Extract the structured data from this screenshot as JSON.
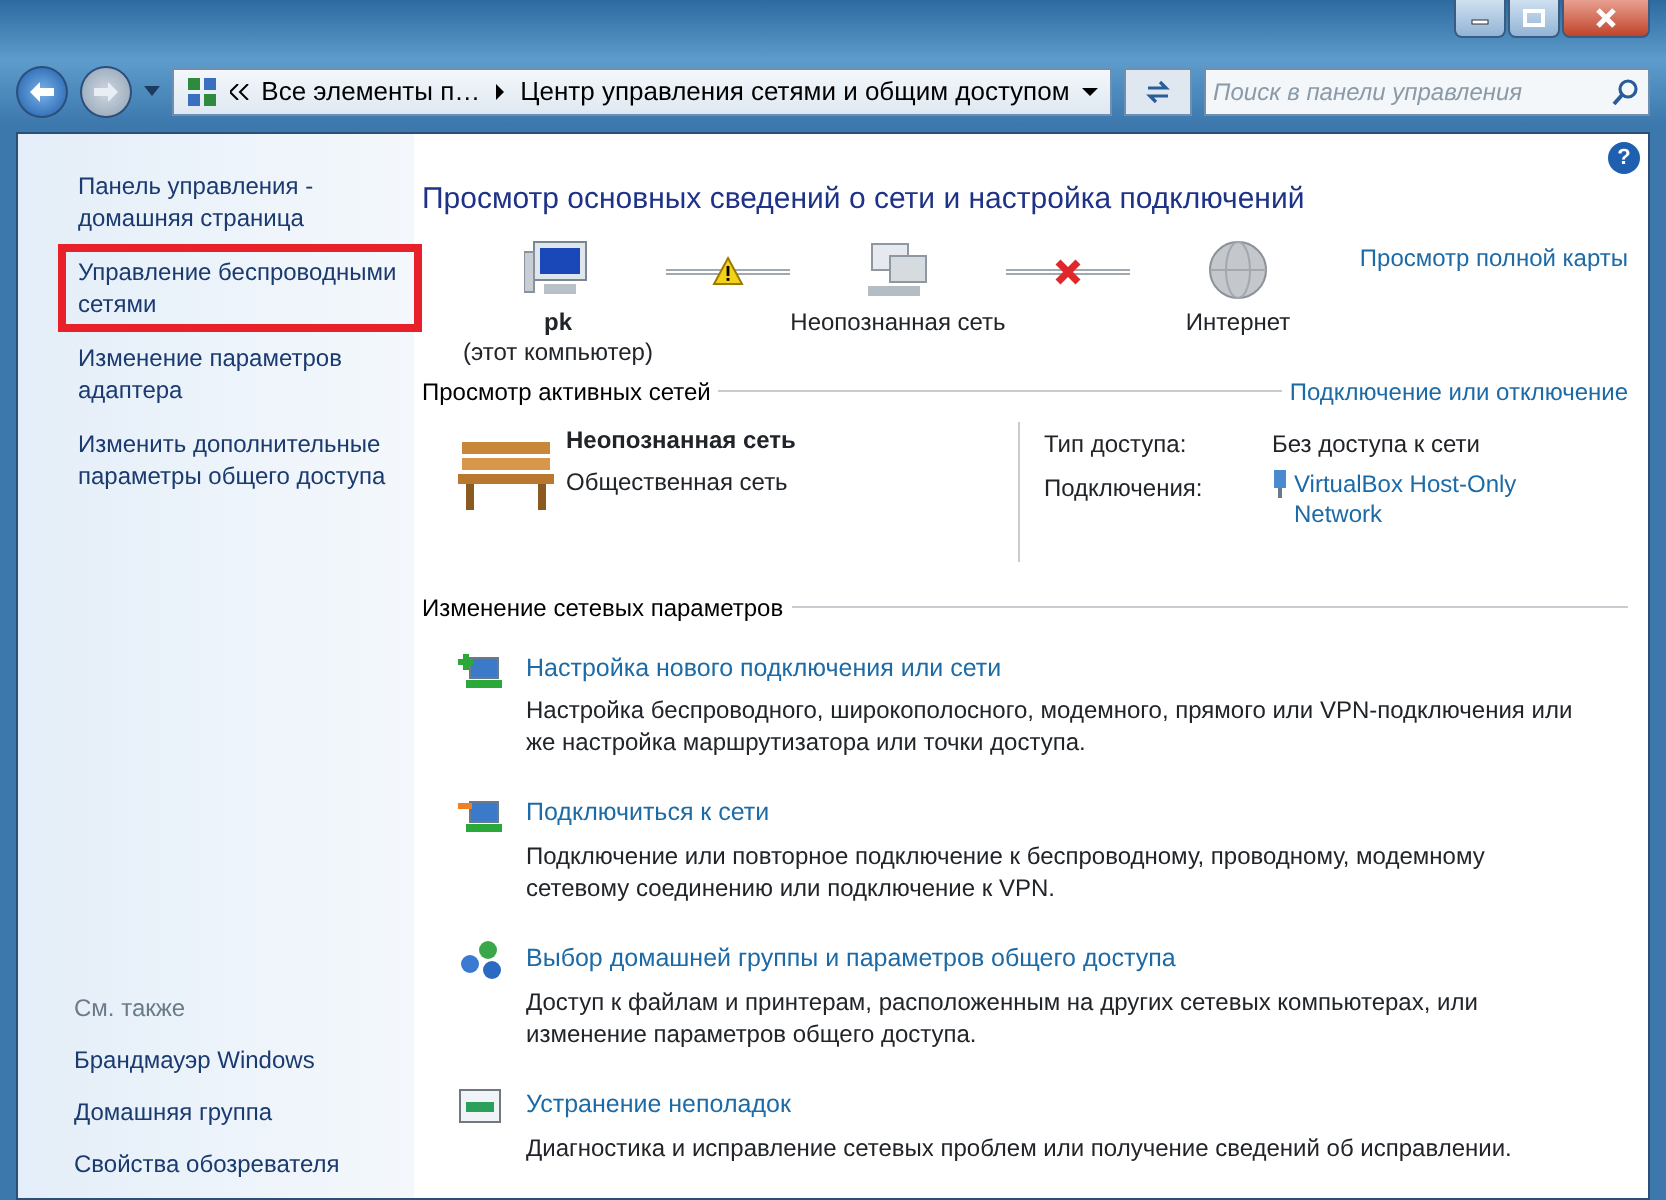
{
  "window": {
    "controls": [
      {
        "kind": "minimize"
      },
      {
        "kind": "maximize"
      },
      {
        "kind": "close"
      }
    ]
  },
  "address": {
    "breadcrumbs": [
      "Все элементы п…",
      "Центр управления сетями и общим доступом"
    ],
    "search": {
      "placeholder": "Поиск в панели управления"
    }
  },
  "sidebar": {
    "links": [
      {
        "text": "Панель управления - домашняя страница",
        "highlighted": false
      },
      {
        "text": "Управление беспроводными сетями",
        "highlighted": true
      },
      {
        "text": "Изменение параметров адаптера",
        "highlighted": false
      },
      {
        "text": "Изменить дополнительные параметры общего доступа",
        "highlighted": false
      }
    ],
    "see_also": {
      "title": "См. также",
      "links": [
        "Брандмауэр Windows",
        "Домашняя группа",
        "Свойства обозревателя"
      ]
    }
  },
  "main": {
    "help_button": "?",
    "title": "Просмотр основных сведений о сети и настройка подключений",
    "map": {
      "nodes": [
        {
          "kind": "computer",
          "label": "pk",
          "sublabel": "(этот компьютер)"
        },
        {
          "kind": "network",
          "label": "Неопознанная сеть"
        },
        {
          "kind": "internet",
          "label": "Интернет"
        }
      ],
      "connectors": [
        {
          "warning": true,
          "broken": false
        },
        {
          "warning": false,
          "broken": true
        }
      ],
      "full_map_link": "Просмотр полной карты"
    },
    "active": {
      "title": "Просмотр активных сетей",
      "link": "Подключение или отключение",
      "network_name": "Неопознанная сеть",
      "network_type": "Общественная сеть",
      "access_label": "Тип доступа:",
      "access_value": "Без доступа к сети",
      "connections_label": "Подключения:",
      "connections_value": "VirtualBox Host-Only Network"
    },
    "settings": {
      "title": "Изменение сетевых параметров",
      "items": [
        {
          "kind": "new-connection",
          "title": "Настройка нового подключения или сети",
          "description": "Настройка беспроводного, широкополосного, модемного, прямого или VPN-подключения или же настройка маршрутизатора или точки доступа."
        },
        {
          "kind": "connect",
          "title": "Подключиться к сети",
          "description": "Подключение или повторное подключение к беспроводному, проводному, модемному сетевому соединению или подключение к VPN."
        },
        {
          "kind": "homegroup",
          "title": "Выбор домашней группы и параметров общего доступа",
          "description": "Доступ к файлам и принтерам, расположенным на других сетевых компьютерах, или изменение параметров общего доступа."
        },
        {
          "kind": "troubleshoot",
          "title": "Устранение неполадок",
          "description": "Диагностика и исправление сетевых проблем или получение сведений об исправлении."
        }
      ]
    }
  }
}
